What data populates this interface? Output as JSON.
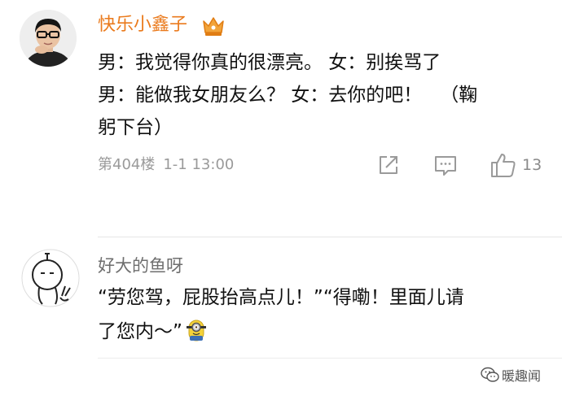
{
  "comments": [
    {
      "username": "快乐小鑫子",
      "avatar": "user-photo-avatar",
      "badge_icon": "vip-crown-icon",
      "text_lines": [
        "男：我觉得你真的很漂亮。 女：别挨骂了",
        "男：能做我女朋友么？ 女：去你的吧！   （鞠",
        "躬下台）"
      ],
      "floor": "第404楼",
      "time": "1-1 13:00",
      "actions": {
        "share_icon": "share-icon",
        "comment_icon": "comment-icon",
        "like_icon": "thumbs-up-icon",
        "like_count": "13"
      }
    },
    {
      "username": "好大的鱼呀",
      "avatar": "doodle-avatar",
      "text_lines": [
        "“劳您驾，屁股抬高点儿！”“得嘞！里面儿请",
        "了您内～”"
      ],
      "emoji": "minion-emoji"
    }
  ],
  "watermark": {
    "icon": "wechat-icon",
    "text": "暖趣闻"
  },
  "colors": {
    "username_primary": "#ea7a1c",
    "username_secondary": "#6e6e6e",
    "meta_gray": "#9a9a9a",
    "divider": "#e6e6e6"
  }
}
